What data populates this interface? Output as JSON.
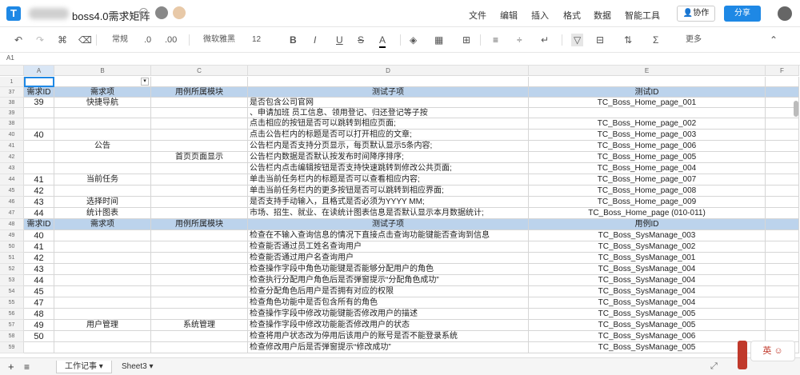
{
  "app": {
    "title": "boss4.0需求矩阵",
    "share": "分享",
    "collab": "协作"
  },
  "menu": [
    "文件",
    "编辑",
    "插入",
    "格式",
    "数据",
    "智能工具"
  ],
  "toolbar": {
    "style": "常规",
    "font": "微软雅黑",
    "size": "12",
    "more": "更多",
    "dec_dec": ".0",
    "dec_inc": ".00",
    "bold": "B",
    "italic": "I",
    "underline": "U",
    "strike": "S",
    "fontcolor": "A"
  },
  "formula": {
    "cell": "A1"
  },
  "columns": [
    "A",
    "B",
    "C",
    "D",
    "E",
    "F"
  ],
  "rows": [
    {
      "n": "1",
      "h": 13,
      "cells": [
        "",
        "",
        "",
        "",
        "",
        ""
      ],
      "type": "blank"
    },
    {
      "n": "37",
      "h": 13,
      "cells": [
        "需求ID",
        "需求项",
        "用例所属模块",
        "测试子项",
        "测试ID",
        ""
      ],
      "type": "header"
    },
    {
      "n": "38",
      "h": 13,
      "cells": [
        "39",
        "快捷导航",
        "",
        "是否包含公司官网",
        "TC_Boss_Home_page_001",
        ""
      ]
    },
    {
      "n": "39",
      "h": 13,
      "cells": [
        "",
        "",
        "",
        "、申请加班  员工信息、领用登记、归还登记等子按",
        "",
        ""
      ]
    },
    {
      "n": "38",
      "h": 14,
      "cells": [
        "",
        "",
        "",
        "点击相应的按钮是否可以跳转到相应页面;",
        "TC_Boss_Home_page_002",
        ""
      ]
    },
    {
      "n": "40",
      "h": 14,
      "cells": [
        "40",
        "",
        "",
        "点击公告栏内的标题是否可以打开相应的文章;",
        "TC_Boss_Home_page_003",
        ""
      ]
    },
    {
      "n": "41",
      "h": 14,
      "cells": [
        "",
        "公告",
        "",
        "公告栏内是否支持分页显示，每页默认显示5条内容;",
        "TC_Boss_Home_page_006",
        ""
      ]
    },
    {
      "n": "42",
      "h": 14,
      "cells": [
        "",
        "",
        "首页页面显示",
        "公告栏内数据是否默认按发布时间降序排序;",
        "TC_Boss_Home_page_005",
        ""
      ]
    },
    {
      "n": "43",
      "h": 14,
      "cells": [
        "",
        "",
        "",
        "公告栏内点击编辑按钮是否支持快速跳转到修改公共页面;",
        "TC_Boss_Home_page_004",
        ""
      ]
    },
    {
      "n": "44",
      "h": 14,
      "cells": [
        "41",
        "当前任务",
        "",
        "单击当前任务栏内的标题是否可以查看相应内容;",
        "TC_Boss_Home_page_007",
        ""
      ]
    },
    {
      "n": "45",
      "h": 14,
      "cells": [
        "42",
        "",
        "",
        "单击当前任务栏内的更多按钮是否可以跳转到相应界面;",
        "TC_Boss_Home_page_008",
        ""
      ]
    },
    {
      "n": "46",
      "h": 14,
      "cells": [
        "43",
        "选择时间",
        "",
        "是否支持手动输入，且格式是否必须为YYYY MM;",
        "TC_Boss_Home_page_009",
        ""
      ]
    },
    {
      "n": "47",
      "h": 14,
      "cells": [
        "44",
        "统计图表",
        "",
        "市场、招生、就业、在读统计图表信息是否默认显示本月数据统计;",
        "TC_Boss_Home_page (010-011)",
        ""
      ]
    },
    {
      "n": "48",
      "h": 14,
      "cells": [
        "需求ID",
        "需求项",
        "用例所属模块",
        "测试子项",
        "用例ID",
        ""
      ],
      "type": "header"
    },
    {
      "n": "49",
      "h": 14,
      "cells": [
        "40",
        "",
        "",
        "检查在不输入查询信息的情况下直接点击查询功能键能否查询到信息",
        "TC_Boss_SysManage_003",
        ""
      ]
    },
    {
      "n": "50",
      "h": 14,
      "cells": [
        "41",
        "",
        "",
        "检查能否通过员工姓名查询用户",
        "TC_Boss_SysManage_002",
        ""
      ]
    },
    {
      "n": "51",
      "h": 14,
      "cells": [
        "42",
        "",
        "",
        "检查能否通过用户名查询用户",
        "TC_Boss_SysManage_001",
        ""
      ]
    },
    {
      "n": "52",
      "h": 14,
      "cells": [
        "43",
        "",
        "",
        "检查操作字段中角色功能键是否能够分配用户的角色",
        "TC_Boss_SysManage_004",
        ""
      ]
    },
    {
      "n": "53",
      "h": 14,
      "cells": [
        "44",
        "",
        "",
        "检查执行分配用户角色后是否弹窗提示“分配角色成功”",
        "TC_Boss_SysManage_004",
        ""
      ]
    },
    {
      "n": "54",
      "h": 14,
      "cells": [
        "45",
        "",
        "",
        "检查分配角色后用户是否拥有对应的权限",
        "TC_Boss_SysManage_004",
        ""
      ]
    },
    {
      "n": "55",
      "h": 14,
      "cells": [
        "47",
        "",
        "",
        "检查角色功能中是否包含所有的角色",
        "TC_Boss_SysManage_004",
        ""
      ]
    },
    {
      "n": "56",
      "h": 14,
      "cells": [
        "48",
        "",
        "",
        "检查操作字段中修改功能键能否修改用户的描述",
        "TC_Boss_SysManage_005",
        ""
      ]
    },
    {
      "n": "57",
      "h": 14,
      "cells": [
        "49",
        "用户管理",
        "系统管理",
        "检查操作字段中修改功能能否修改用户的状态",
        "TC_Boss_SysManage_005",
        ""
      ]
    },
    {
      "n": "58",
      "h": 14,
      "cells": [
        "50",
        "",
        "",
        "检查将用户状态改为停用后该用户的账号是否不能登录系统",
        "TC_Boss_SysManage_006",
        ""
      ]
    },
    {
      "n": "59",
      "h": 14,
      "cells": [
        "",
        "",
        "",
        "检查修改用户后是否弹窗提示“修改成功”",
        "TC_Boss_SysManage_005",
        ""
      ]
    }
  ],
  "sheets": [
    "工作记事",
    "Sheet3"
  ],
  "ime": "英"
}
